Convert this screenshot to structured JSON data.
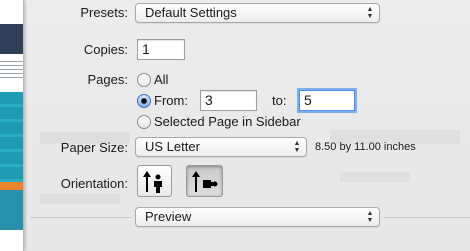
{
  "presets": {
    "label": "Presets:",
    "value": "Default Settings"
  },
  "copies": {
    "label": "Copies:",
    "value": "1"
  },
  "pages": {
    "label": "Pages:",
    "all_label": "All",
    "from_label": "From:",
    "from_value": "3",
    "to_label": "to:",
    "to_value": "5",
    "selected_label": "Selected Page in Sidebar",
    "selected_option": "from"
  },
  "paper_size": {
    "label": "Paper Size:",
    "value": "US Letter",
    "dimensions": "8.50 by 11.00 inches"
  },
  "orientation": {
    "label": "Orientation:",
    "selected": "landscape"
  },
  "section_popup": {
    "value": "Preview"
  },
  "colors": {
    "focus": "#4a8ee6",
    "radio_selected": "#3a6fc8"
  }
}
